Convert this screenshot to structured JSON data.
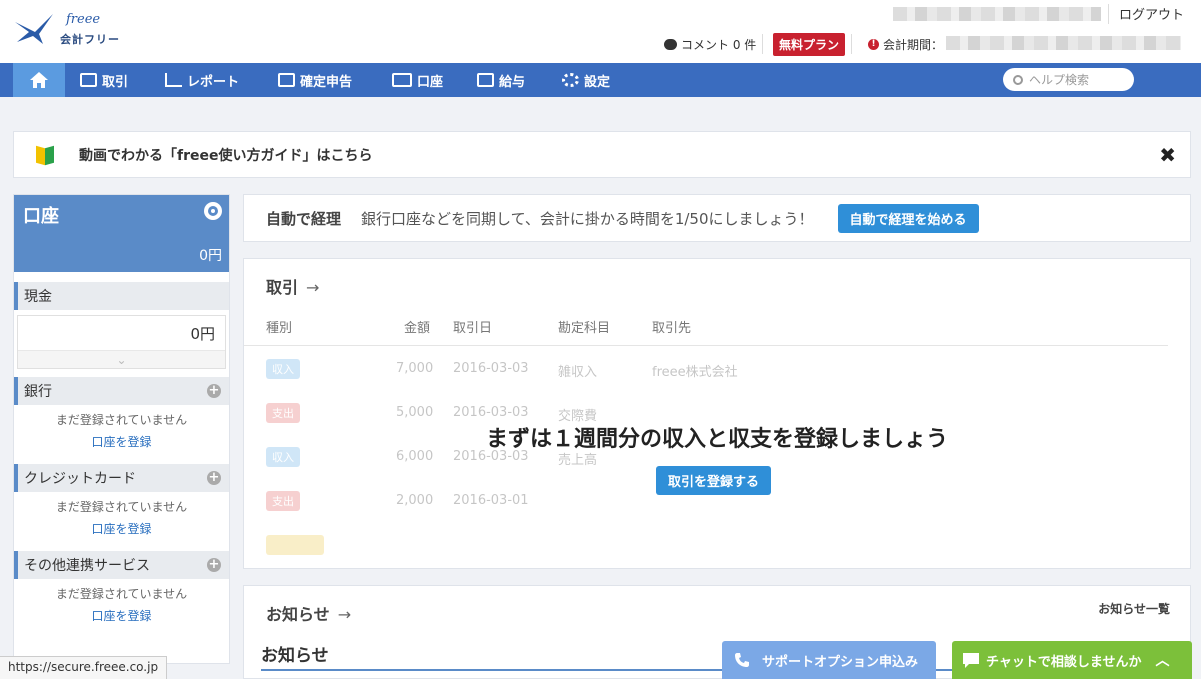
{
  "header": {
    "logo_word": "freee",
    "logo_sub": "会計フリー",
    "logout": "ログアウト",
    "comment": "コメント 0 件",
    "plan_badge": "無料プラン",
    "period_label": "会計期間："
  },
  "nav": {
    "items": [
      {
        "label": "取引"
      },
      {
        "label": "レポート"
      },
      {
        "label": "確定申告"
      },
      {
        "label": "口座"
      },
      {
        "label": "給与"
      },
      {
        "label": "設定"
      }
    ],
    "search_placeholder": "ヘルプ検索"
  },
  "guide": {
    "text": "動画でわかる「freee使い方ガイド」はこちら",
    "close": "✖"
  },
  "sidebar": {
    "title": "口座",
    "total": "0円",
    "cash": {
      "label": "現金",
      "amount": "0円"
    },
    "sections": [
      {
        "label": "銀行",
        "note": "まだ登録されていません",
        "link": "口座を登録"
      },
      {
        "label": "クレジットカード",
        "note": "まだ登録されていません",
        "link": "口座を登録"
      },
      {
        "label": "その他連携サービス",
        "note": "まだ登録されていません",
        "link": "口座を登録"
      }
    ]
  },
  "auto": {
    "title": "自動で経理",
    "desc": "銀行口座などを同期して、会計に掛かる時間を1/50にしましょう！",
    "button": "自動で経理を始める"
  },
  "transactions": {
    "title": "取引",
    "arrow": "→",
    "headers": [
      "種別",
      "金額",
      "取引日",
      "勘定科目",
      "取引先"
    ],
    "rows": [
      {
        "type": "収入",
        "color": "#5aa9e6",
        "amount": "7,000",
        "date": "2016-03-03",
        "account": "雑収入",
        "partner": "freee株式会社"
      },
      {
        "type": "支出",
        "color": "#e05a5a",
        "amount": "5,000",
        "date": "2016-03-03",
        "account": "交際費",
        "partner": ""
      },
      {
        "type": "収入",
        "color": "#5aa9e6",
        "amount": "6,000",
        "date": "2016-03-03",
        "account": "売上高",
        "partner": ""
      },
      {
        "type": "支出",
        "color": "#e05a5a",
        "amount": "2,000",
        "date": "2016-03-01",
        "account": "",
        "partner": ""
      },
      {
        "type": "",
        "color": "#e8c23a",
        "amount": "",
        "date": "",
        "account": "",
        "partner": ""
      }
    ],
    "overlay_message": "まずは１週間分の収入と収支を登録しましょう",
    "overlay_button": "取引を登録する"
  },
  "news": {
    "title": "お知らせ",
    "arrow": "→",
    "all_link": "お知らせ一覧",
    "sub_title": "お知らせ"
  },
  "floating": {
    "support": "サポートオプション申込み",
    "chat": "チャットで相談しませんか",
    "chat_chevron": "︿"
  },
  "status_url": "https://secure.freee.co.jp",
  "colors": {
    "nav": "#3a6cbf",
    "accent": "#2f8fd8",
    "plan": "#c8212f",
    "chat": "#7cc03a"
  }
}
